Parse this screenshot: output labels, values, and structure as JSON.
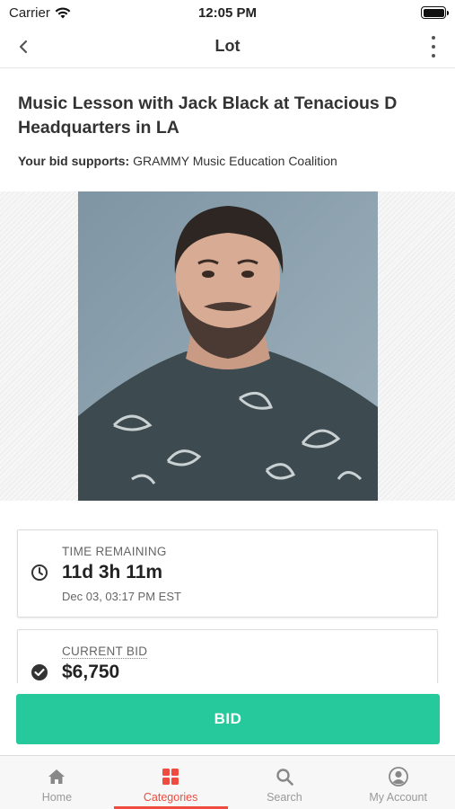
{
  "status": {
    "carrier": "Carrier",
    "time": "12:05 PM",
    "icons": [
      "wifi-icon",
      "battery-icon"
    ]
  },
  "nav": {
    "title": "Lot",
    "back_icon": "chevron-left-icon",
    "more_icon": "more-vertical-icon"
  },
  "lot": {
    "title": "Music Lesson with Jack Black at Tenacious D Headquarters in LA",
    "supports_label": "Your bid supports:",
    "supports_value": "GRAMMY Music Education Coalition"
  },
  "time_card": {
    "label": "TIME REMAINING",
    "value": "11d 3h 11m",
    "sub": "Dec 03, 03:17 PM EST",
    "icon": "clock-icon"
  },
  "bid_card": {
    "label": "CURRENT BID",
    "value": "$6,750",
    "icon": "check-circle-icon"
  },
  "bid_button": {
    "label": "BID",
    "color": "#25c99b"
  },
  "tabs": [
    {
      "label": "Home",
      "icon": "home-icon",
      "active": false
    },
    {
      "label": "Categories",
      "icon": "grid-icon",
      "active": true
    },
    {
      "label": "Search",
      "icon": "search-icon",
      "active": false
    },
    {
      "label": "My Account",
      "icon": "account-icon",
      "active": false
    }
  ],
  "colors": {
    "accent": "#ef4b3f",
    "bid": "#25c99b"
  }
}
